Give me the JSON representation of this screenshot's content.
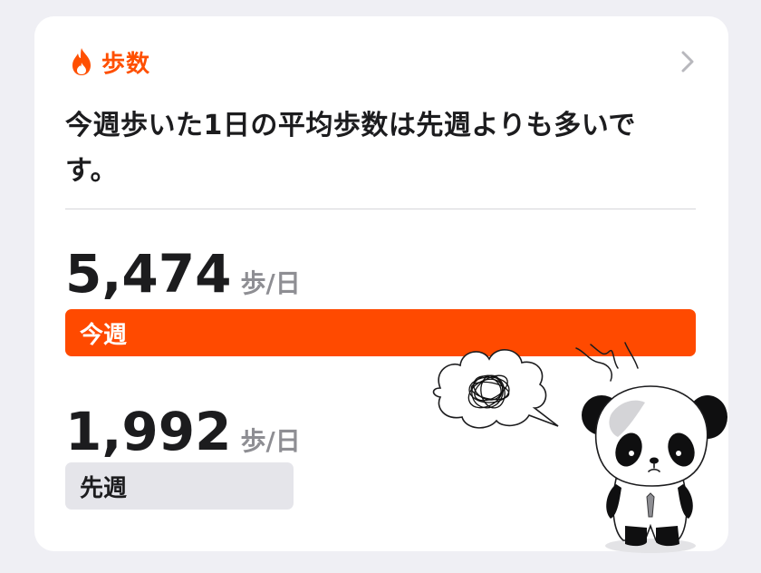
{
  "card": {
    "title": "歩数",
    "headline": "今週歩いた1日の平均歩数は先週よりも多いです。",
    "icons": {
      "header": "flame-icon",
      "navigate": "chevron-right-icon"
    },
    "colors": {
      "accent": "#ff4a00",
      "last_week_bar": "#e5e5ea",
      "background": "#efeff4"
    }
  },
  "this_week": {
    "value": "5,474",
    "unit": "歩/日",
    "label": "今週"
  },
  "last_week": {
    "value": "1,992",
    "unit": "歩/日",
    "label": "先週"
  },
  "sticker": {
    "description_icon": "panda-sticker"
  }
}
